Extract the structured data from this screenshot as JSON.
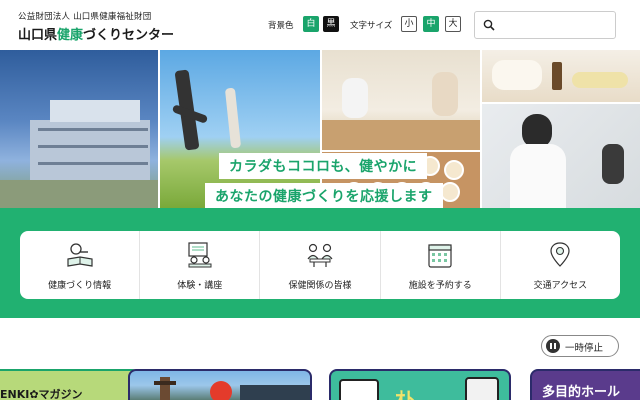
{
  "header": {
    "org_line": "公益財団法人 山口県健康福祉財団",
    "title_prefix": "山口県",
    "title_accent": "健康",
    "title_suffix": "づくりセンター",
    "bg_label": "背景色",
    "bg_white": "白",
    "bg_black": "黒",
    "font_size_label": "文字サイズ",
    "size_small": "小",
    "size_medium": "中",
    "size_large": "大",
    "search_placeholder": ""
  },
  "hero": {
    "tagline_1": "カラダもココロも、健やかに",
    "tagline_2": "あなたの健康づくりを応援します"
  },
  "nav": {
    "items": [
      {
        "label": "健康づくり情報",
        "icon": "book-magnifier-icon"
      },
      {
        "label": "体験・講座",
        "icon": "lecture-icon"
      },
      {
        "label": "保健関係の皆様",
        "icon": "people-meeting-icon"
      },
      {
        "label": "施設を予約する",
        "icon": "calendar-icon"
      },
      {
        "label": "交通アクセス",
        "icon": "map-pin-icon"
      }
    ]
  },
  "carousel": {
    "pause_label": "一時停止"
  },
  "cards": {
    "card1_text": "ENKI✿マガジン",
    "card3_text": "ｵﾄ",
    "card4_text": "多目的ホール"
  },
  "colors": {
    "brand_green": "#1aa46b",
    "band_green": "#21b171"
  }
}
